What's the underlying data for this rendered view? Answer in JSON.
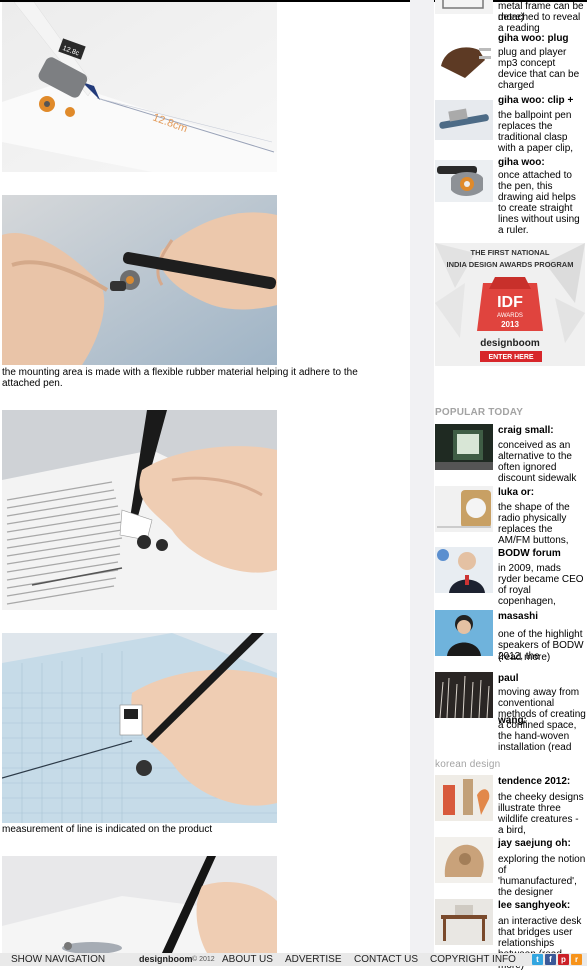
{
  "article": {
    "captions": {
      "mounting": "the mounting area is made with a flexible rubber material helping it adhere to the attached pen.",
      "measurement": "measurement of line is indicated on the product"
    },
    "product_display": "12.8c",
    "ruler_reading": "12.8cm"
  },
  "sidebar": {
    "related": [
      {
        "title": "",
        "desc": "metal frame can be detached to reveal a reading"
      },
      {
        "title": "giha woo: plug",
        "desc": "plug and player mp3 concept device that can be charged"
      },
      {
        "title": "giha woo: clip +",
        "desc": "the ballpoint pen replaces the traditional clasp with a paper clip,"
      },
      {
        "title": "giha woo:",
        "desc": "once attached to the pen, this drawing aid helps to create straight lines without using a ruler."
      }
    ],
    "ad": {
      "headline_1": "THE FIRST NATIONAL",
      "headline_2": "INDIA DESIGN AWARDS PROGRAM",
      "badge_main": "IDF",
      "badge_sub": "AWARDS",
      "badge_year": "2013",
      "brand": "designboom",
      "cta": "ENTER HERE"
    },
    "popular_heading": "POPULAR TODAY",
    "popular": [
      {
        "title": "craig small:",
        "desc": "conceived as an alternative to the often ignored discount sidewalk"
      },
      {
        "title": "luka or:",
        "desc": "the shape of the radio physically replaces the AM/FM buttons,"
      },
      {
        "title": "BODW forum",
        "desc": "in 2009, mads ryder became CEO of royal copenhagen,"
      },
      {
        "title": "masashi",
        "desc": "one of the highlight speakers of BODW 2012, the"
      },
      {
        "title": "paul",
        "desc": "moving away from conventional methods of creating a confined space, the hand-woven installation (read"
      }
    ],
    "overlap_texts": [
      "more)",
      "(read more)",
      "wang:"
    ],
    "korean_heading": "korean design",
    "korean": [
      {
        "title": "tendence 2012:",
        "desc": "the cheeky designs illustrate three wildlife creatures - a bird,"
      },
      {
        "title": "jay saejung oh:",
        "desc": "exploring the notion of 'humanufactured', the designer"
      },
      {
        "title": "lee sanghyeok:",
        "desc": "an interactive desk that bridges user relationships between (read more)"
      }
    ]
  },
  "footer": {
    "show_navigation": "SHOW NAVIGATION",
    "brand": "designboom",
    "copyright": "© 2012",
    "links": [
      "ABOUT US",
      "ADVERTISE",
      "CONTACT US",
      "COPYRIGHT INFO"
    ],
    "social": [
      {
        "name": "twitter-icon",
        "glyph": "t",
        "color": "#33a6e0"
      },
      {
        "name": "facebook-icon",
        "glyph": "f",
        "color": "#3b5998"
      },
      {
        "name": "pinterest-icon",
        "glyph": "p",
        "color": "#cb2027"
      },
      {
        "name": "rss-icon",
        "glyph": "r",
        "color": "#f7931a"
      }
    ]
  }
}
